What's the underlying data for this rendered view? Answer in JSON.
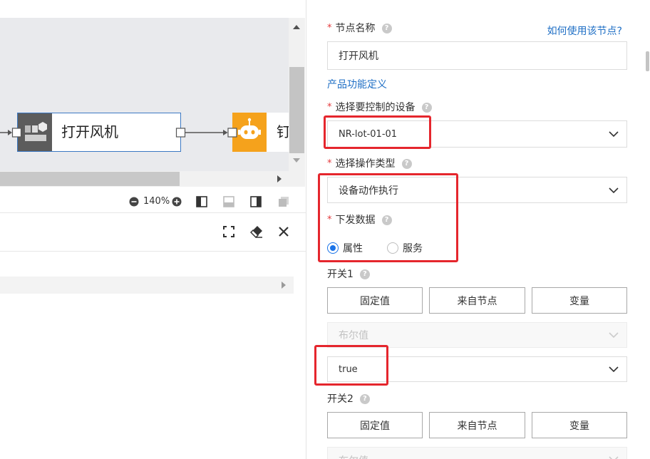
{
  "canvas": {
    "nodes": [
      {
        "label": "打开风机",
        "icon": "device-icon"
      },
      {
        "label": "钉",
        "icon": "robot-icon"
      }
    ]
  },
  "toolbar": {
    "zoom": "140%",
    "icons": [
      "zoom-out-icon",
      "zoom-in-icon",
      "layout-left-panel-icon",
      "layout-bottom-panel-icon",
      "layout-right-panel-icon",
      "copy-icon"
    ]
  },
  "panel_actions": {
    "icons": [
      "fullscreen-icon",
      "eraser-icon",
      "close-icon"
    ]
  },
  "form": {
    "required_mark": "*",
    "help_link": "如何使用该节点?",
    "node_name": {
      "label": "节点名称",
      "value": "打开风机"
    },
    "product_link": "产品功能定义",
    "device": {
      "label": "选择要控制的设备",
      "value": "NR-lot-01-01"
    },
    "operation": {
      "label": "选择操作类型",
      "value": "设备动作执行"
    },
    "send_data": {
      "label": "下发数据",
      "options": [
        {
          "label": "属性",
          "checked": true
        },
        {
          "label": "服务",
          "checked": false
        }
      ]
    },
    "switches": [
      {
        "label": "开关1",
        "source_buttons": [
          "固定值",
          "来自节点",
          "变量"
        ],
        "type_placeholder": "布尔值",
        "value": "true"
      },
      {
        "label": "开关2",
        "source_buttons": [
          "固定值",
          "来自节点",
          "变量"
        ],
        "type_placeholder": "布尔值"
      }
    ]
  },
  "colors": {
    "accent": "#1a73e8",
    "link": "#1f6fc5",
    "required": "#e4393c",
    "annotation": "#e5262d",
    "node_selected_border": "#3b78c3",
    "device_icon_bg": "#5c5c5c",
    "robot_icon_bg": "#f5a21c"
  }
}
